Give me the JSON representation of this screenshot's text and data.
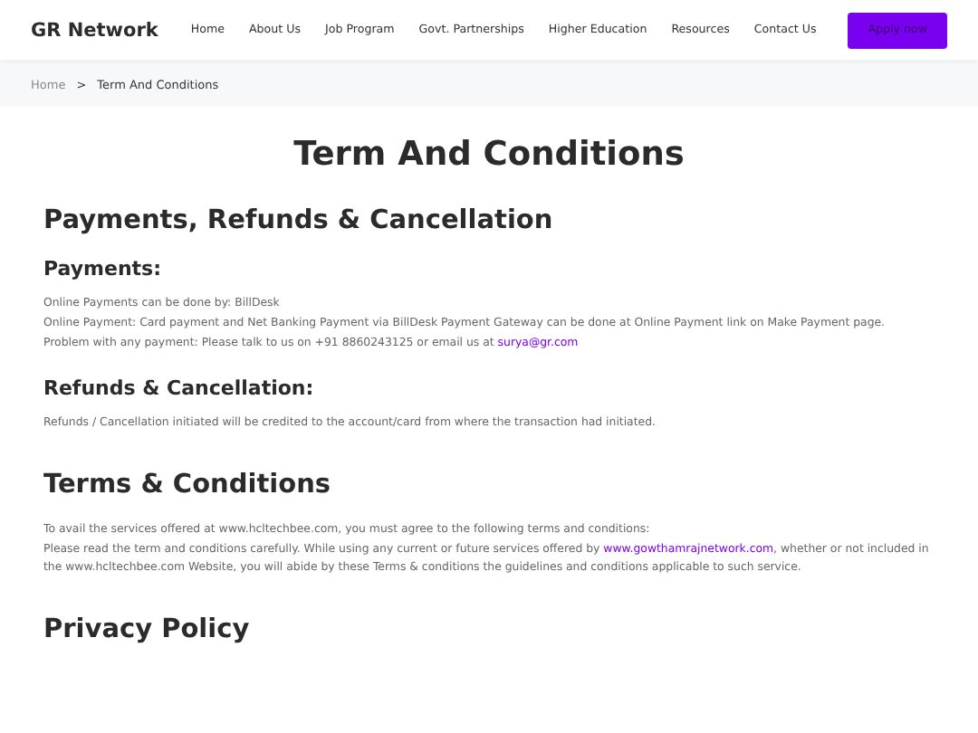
{
  "header": {
    "logo": "GR Network",
    "nav": [
      {
        "label": "Home"
      },
      {
        "label": "About Us"
      },
      {
        "label": "Job Program"
      },
      {
        "label": "Govt. Partnerships"
      },
      {
        "label": "Higher Education"
      },
      {
        "label": "Resources"
      },
      {
        "label": "Contact Us"
      }
    ],
    "cta": "Apply now"
  },
  "breadcrumb": {
    "home": "Home",
    "separator": ">",
    "current": "Term And Conditions"
  },
  "page_title": "Term And Conditions",
  "sections": [
    {
      "kind": "h2",
      "text": "Payments, Refunds & Cancellation"
    },
    {
      "kind": "h3",
      "text": "Payments:"
    },
    {
      "kind": "p",
      "lines": [
        {
          "text": "Online Payments can be done by: BillDesk"
        },
        {
          "text": "Online Payment: Card payment and Net Banking Payment via BillDesk Payment Gateway can be done at Online Payment link on Make Payment page."
        },
        {
          "text": "Problem with any payment: Please talk to us on +91 8860243125 or email us at ",
          "link": "surya@gr.com"
        }
      ]
    },
    {
      "kind": "h3",
      "text": "Refunds & Cancellation:"
    },
    {
      "kind": "p",
      "lines": [
        {
          "text": "Refunds / Cancellation initiated will be credited to the account/card from where the transaction had initiated."
        }
      ]
    },
    {
      "kind": "h2",
      "text": "Terms & Conditions"
    },
    {
      "kind": "p",
      "lines": [
        {
          "text": "To avail the services offered at www.hcltechbee.com, you must agree to the following terms and conditions:"
        },
        {
          "text": "Please read the term and conditions carefully. While using any current or future services offered by ",
          "link": "www.gowthamrajnetwork.com",
          "after": ", whether or not included in the www.hcltechbee.com Website, you will abide by these Terms & conditions the guidelines and conditions applicable to such service."
        }
      ]
    },
    {
      "kind": "h2",
      "text": "Privacy Policy"
    }
  ]
}
